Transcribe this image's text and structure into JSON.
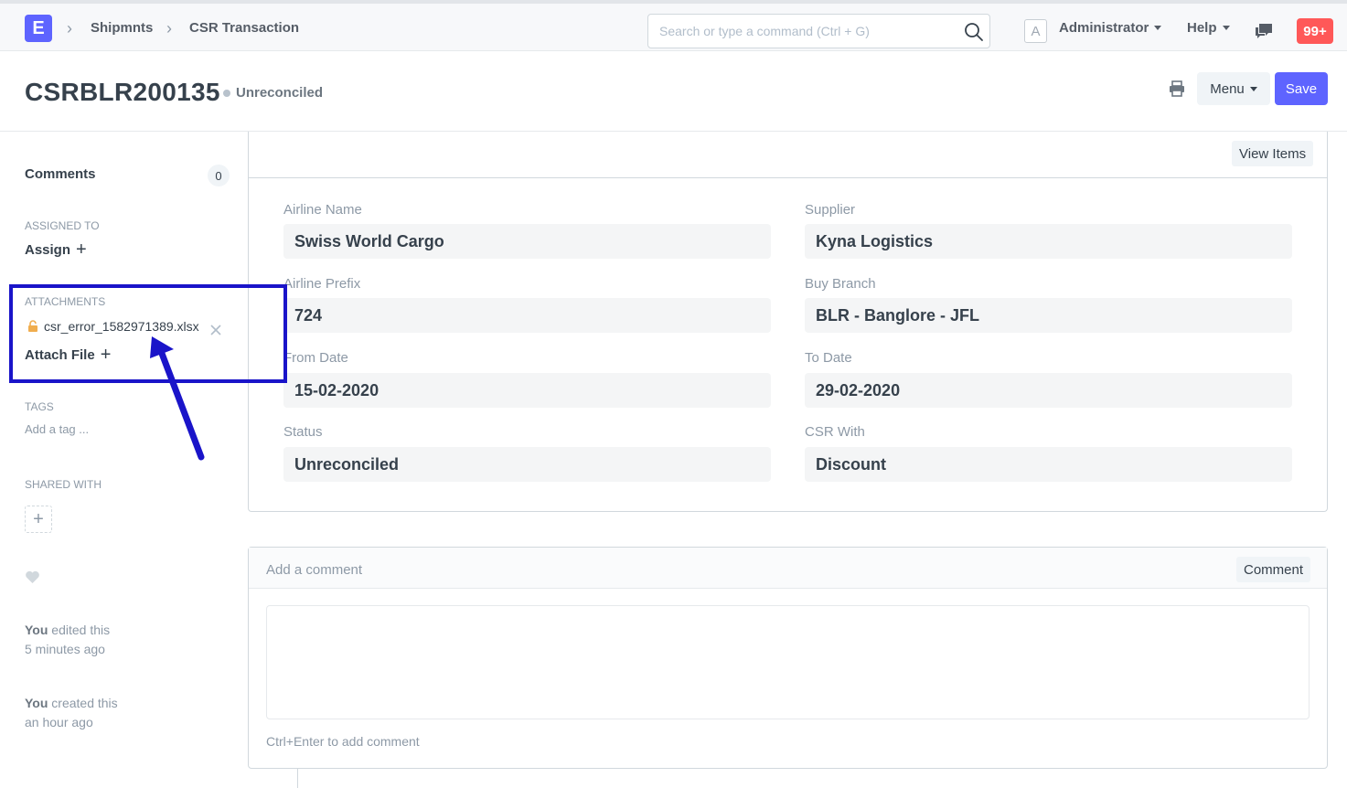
{
  "navbar": {
    "logo_letter": "E",
    "breadcrumbs": [
      "Shipmnts",
      "CSR Transaction"
    ],
    "search_placeholder": "Search or type a command (Ctrl + G)",
    "avatar_letter": "A",
    "user_label": "Administrator",
    "help_label": "Help",
    "notification_count": "99+"
  },
  "page": {
    "title": "CSRBLR200135",
    "status": "Unreconciled",
    "menu_label": "Menu",
    "save_label": "Save"
  },
  "sidebar": {
    "comments_label": "Comments",
    "comments_count": "0",
    "assigned_to_label": "ASSIGNED TO",
    "assign_label": "Assign",
    "attachments_label": "ATTACHMENTS",
    "attachment_filename": "csr_error_1582971389.xlsx",
    "attach_file_label": "Attach File",
    "tags_label": "TAGS",
    "add_tag_label": "Add a tag ...",
    "shared_with_label": "SHARED WITH",
    "timeline": [
      {
        "who": "You",
        "action": "edited this",
        "when": "5 minutes ago"
      },
      {
        "who": "You",
        "action": "created this",
        "when": "an hour ago"
      }
    ]
  },
  "form": {
    "view_items_label": "View Items",
    "fields": {
      "airline_name": {
        "label": "Airline Name",
        "value": "Swiss World Cargo"
      },
      "supplier": {
        "label": "Supplier",
        "value": "Kyna Logistics"
      },
      "airline_prefix": {
        "label": "Airline Prefix",
        "value": "724"
      },
      "buy_branch": {
        "label": "Buy Branch",
        "value": "BLR - Banglore - JFL"
      },
      "from_date": {
        "label": "From Date",
        "value": "15-02-2020"
      },
      "to_date": {
        "label": "To Date",
        "value": "29-02-2020"
      },
      "status": {
        "label": "Status",
        "value": "Unreconciled"
      },
      "csr_with": {
        "label": "CSR With",
        "value": "Discount"
      }
    }
  },
  "comment": {
    "title": "Add a comment",
    "button_label": "Comment",
    "hint": "Ctrl+Enter to add comment"
  },
  "colors": {
    "brand": "#5e64ff",
    "notification": "#ff5858",
    "annotation": "#1a14c9"
  }
}
